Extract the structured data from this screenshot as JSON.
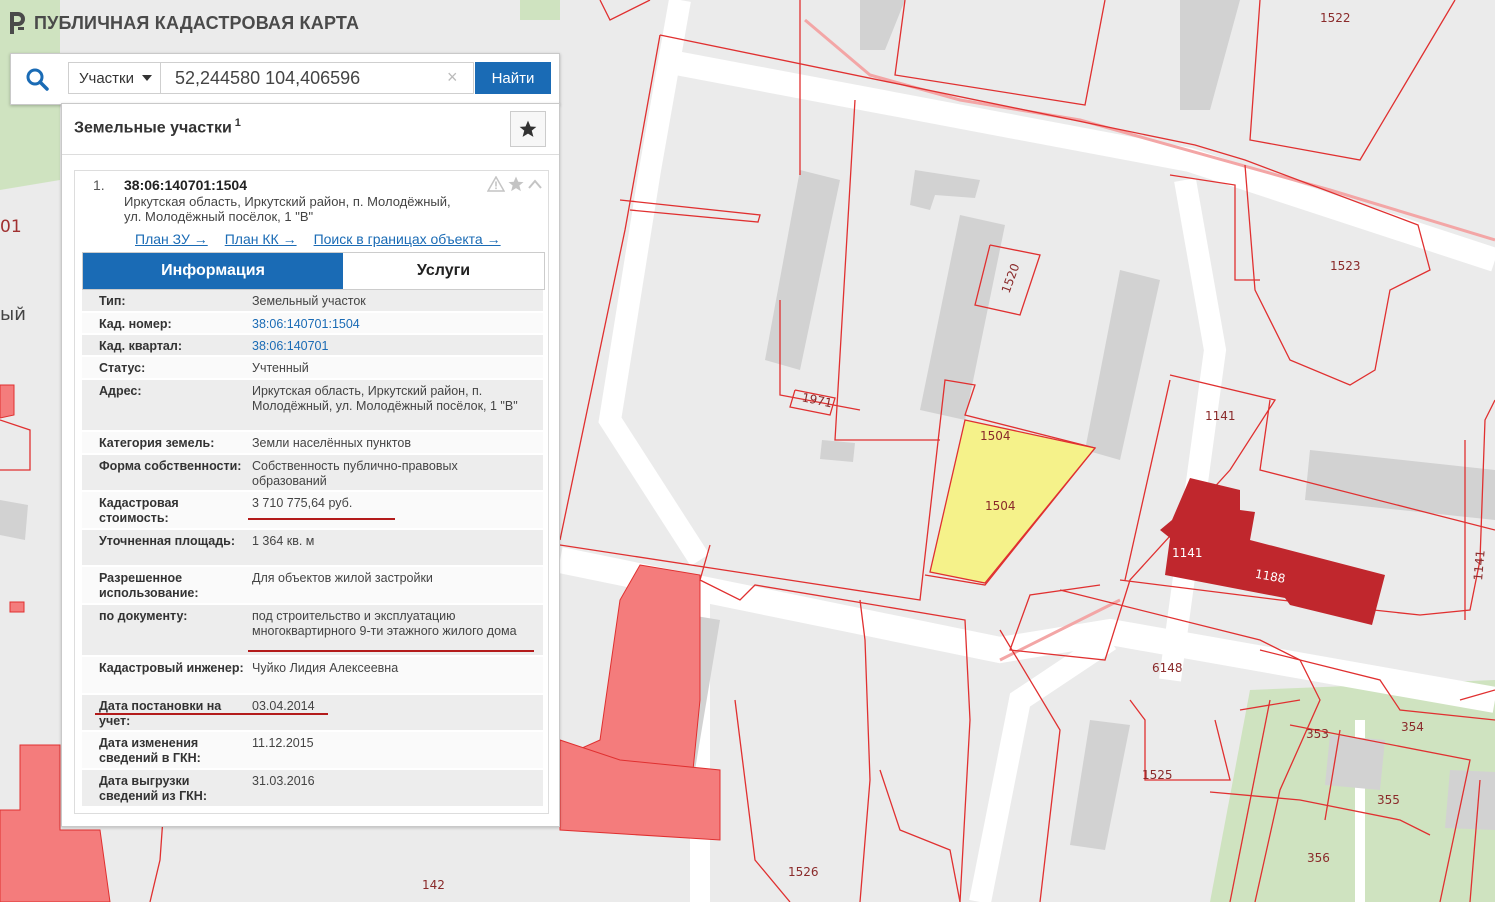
{
  "app": {
    "title": "ПУБЛИЧНАЯ КАДАСТРОВАЯ КАРТА"
  },
  "search": {
    "type_label": "Участки",
    "query": "52,244580 104,406596",
    "button_label": "Найти",
    "clear_symbol": "×"
  },
  "panel": {
    "title": "Земельные участки",
    "count": "1",
    "item": {
      "index": "1.",
      "cad_number": "38:06:140701:1504",
      "address": "Иркутская область, Иркутский район, п. Молодёжный, ул. Молодёжный посёлок, 1 \"В\"",
      "links": [
        "План ЗУ →",
        "План КК →",
        "Поиск в границах объекта →"
      ],
      "tabs": {
        "info": "Информация",
        "services": "Услуги"
      },
      "details": [
        {
          "key": "Тип:",
          "value": "Земельный участок"
        },
        {
          "key": "Кад. номер:",
          "value": "38:06:140701:1504",
          "link": true
        },
        {
          "key": "Кад. квартал:",
          "value": "38:06:140701",
          "link": true
        },
        {
          "key": "Статус:",
          "value": "Учтенный"
        },
        {
          "key": "Адрес:",
          "value": "Иркутская область, Иркутский район, п. Молодёжный, ул. Молодёжный посёлок, 1 \"В\""
        },
        {
          "key": "Категория земель:",
          "value": "Земли населённых пунктов"
        },
        {
          "key": "Форма собственности:",
          "value": "Собственность публично-правовых образований"
        },
        {
          "key": "Кадастровая стоимость:",
          "value": "3 710 775,64 руб."
        },
        {
          "key": "Уточненная площадь:",
          "value": "1 364 кв. м"
        },
        {
          "key": "Разрешенное использование:",
          "value": "Для объектов жилой застройки"
        },
        {
          "key": "по документу:",
          "value": "под строительство и эксплуатацию многоквартирного 9-ти этажного жилого дома"
        },
        {
          "key": "Кадастровый инженер:",
          "value": "Чуйко Лидия Алексеевна"
        },
        {
          "key": "Дата постановки на учет:",
          "value": "03.04.2014"
        },
        {
          "key": "Дата изменения сведений в ГКН:",
          "value": "11.12.2015"
        },
        {
          "key": "Дата выгрузки сведений из ГКН:",
          "value": "31.03.2016"
        }
      ]
    }
  },
  "map_labels": [
    "1522",
    "1523",
    "1520",
    "1971",
    "1504",
    "1504",
    "1141",
    "1141",
    "1188",
    "1141",
    "6148",
    "353",
    "354",
    "355",
    "356",
    "1525",
    "1526",
    "142",
    "01",
    "ый"
  ],
  "colors": {
    "accent": "#1a6bb5",
    "parcel_outline": "#e03030",
    "selected_parcel": "#f5f28a",
    "building_red": "#c0272d",
    "annotation": "#b31b1b"
  }
}
